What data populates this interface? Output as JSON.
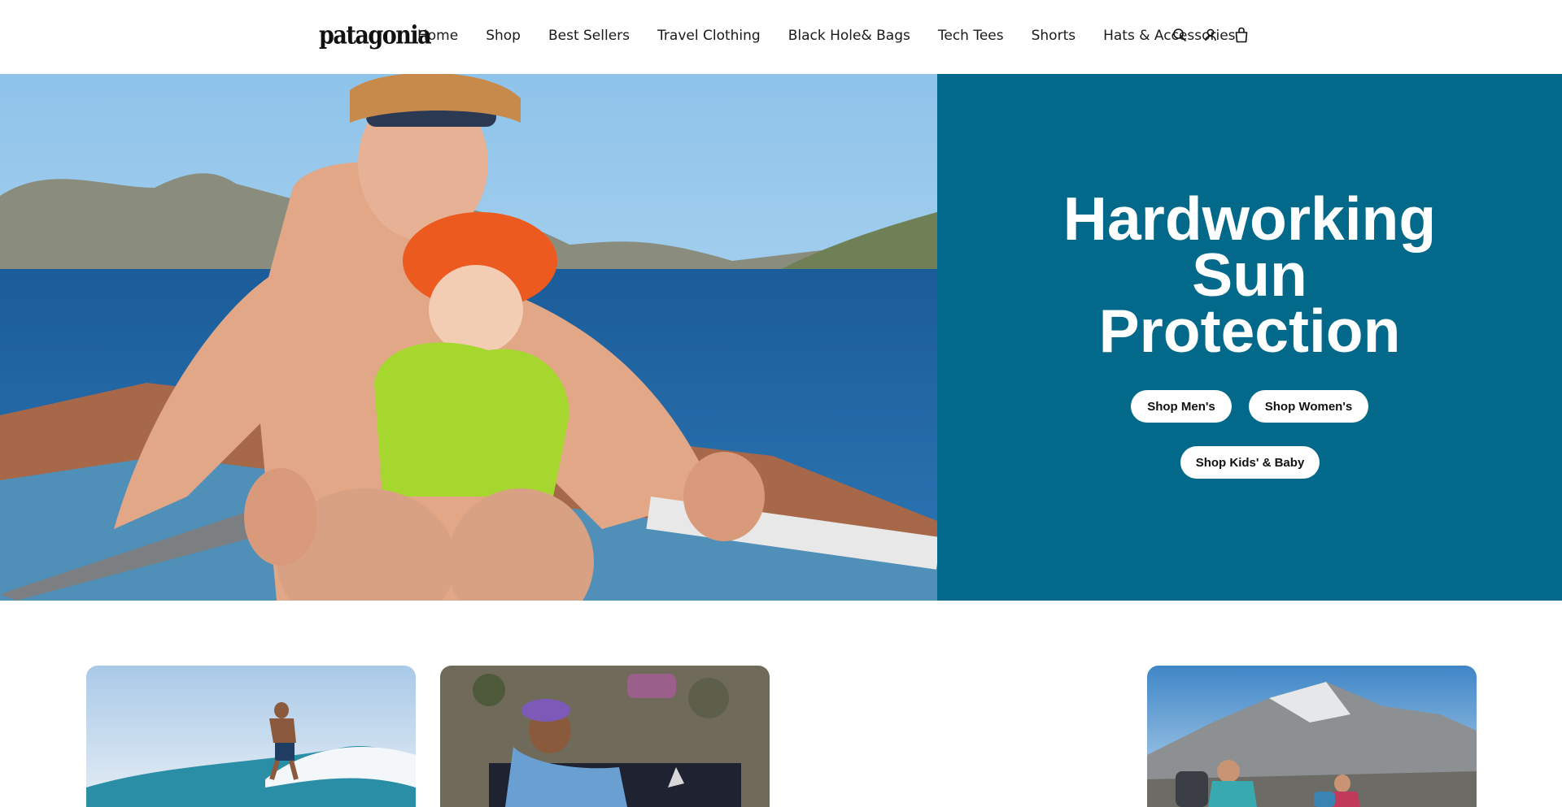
{
  "header": {
    "logo": "patagonia",
    "nav": [
      "Home",
      "Shop",
      "Best Sellers",
      "Travel Clothing",
      "Black Hole& Bags",
      "Tech Tees",
      "Shorts",
      "Hats & Accessories"
    ],
    "icons": [
      "search-icon",
      "account-icon",
      "cart-icon"
    ]
  },
  "hero": {
    "title_lines": [
      "Hardworking",
      "Sun",
      "Protection"
    ],
    "buttons": {
      "men": "Shop Men's",
      "women": "Shop Women's",
      "kids": "Shop Kids' & Baby"
    },
    "panel_color": "#02698a"
  }
}
